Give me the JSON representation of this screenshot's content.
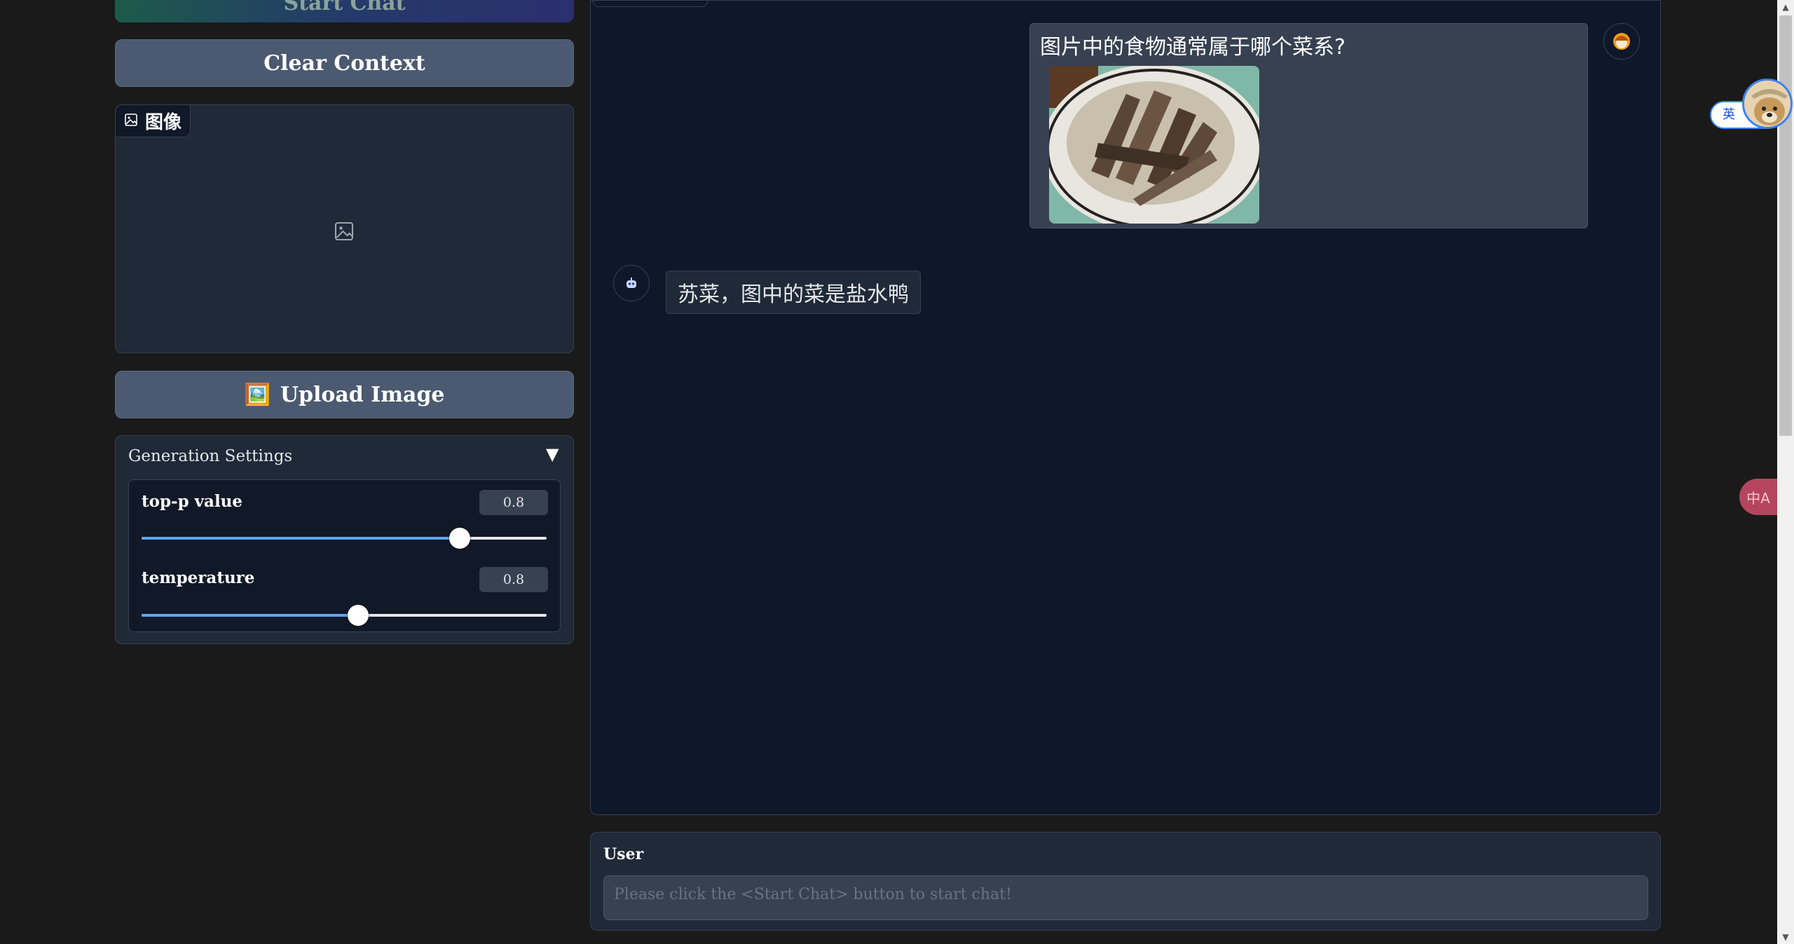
{
  "left_panel": {
    "start_chat_label": "Start Chat",
    "clear_context_label": "Clear Context",
    "image_panel_label": "图像",
    "upload_image_label": "Upload Image",
    "upload_image_emoji": "🖼️",
    "generation_settings": {
      "title": "Generation Settings",
      "toggle_glyph": "▼",
      "sliders": [
        {
          "label": "top-p value",
          "value": "0.8",
          "fraction": 0.785
        },
        {
          "label": "temperature",
          "value": "0.8",
          "fraction": 0.535
        }
      ]
    }
  },
  "chat": {
    "messages": [
      {
        "role": "user",
        "text": "图片中的食物通常属于哪个菜系?",
        "has_image": true
      },
      {
        "role": "bot",
        "text": "苏菜，图中的菜是盐水鸭"
      }
    ]
  },
  "input": {
    "label": "User",
    "placeholder": "Please click the <Start Chat> button to start chat!"
  },
  "overlays": {
    "language_badge": "英",
    "translate_glyph": "中A"
  },
  "colors": {
    "accent": "#60a5fa",
    "button": "#4b5a70",
    "chat_bg": "#0f172a",
    "panel_bg": "#1f2937"
  }
}
